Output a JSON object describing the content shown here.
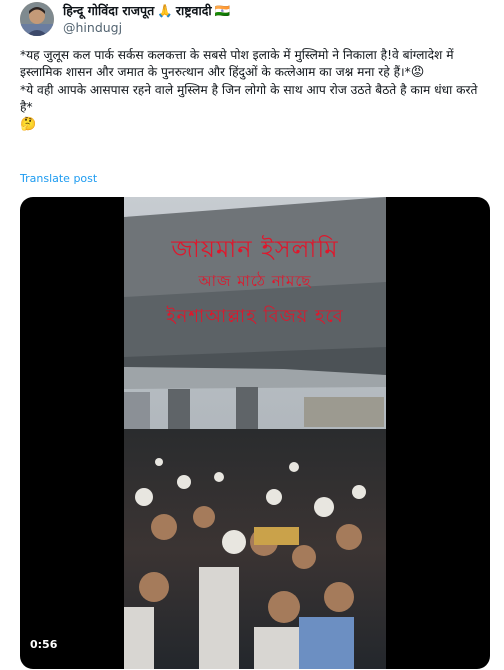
{
  "author": {
    "name": "हिन्दू गोविंदा राजपूत",
    "praying_hands_icon": "🙏",
    "suffix": "राष्ट्रवादी",
    "flag_icon": "🇮🇳",
    "handle": "@hindugj"
  },
  "tweet": {
    "line1": "*यह जुलूस कल पार्क सर्कस कलकत्ता के सबसे पोश इलाके में मुस्लिमो ने निकाला है!वे बांग्लादेश में इस्लामिक शासन और जमात के पुनरुत्थान और हिंदुओं के कत्लेआम का जश्न मना रहे हैं।*",
    "angry_emoji": "😡",
    "line2": "*ये वही आपके आसपास रहने वाले मुस्लिम है  जिन लोगो के साथ आप रोज उठते बैठते है काम धंधा करते है*",
    "thinking_emoji": "🤔"
  },
  "translate_label": "Translate post",
  "video": {
    "caption_line1": "জায়মান ইসলামি",
    "caption_line2": "আজ মাঠে নামছে",
    "caption_line3": "ইনশাআল্লাহ বিজয় হবে",
    "duration": "0:56"
  }
}
